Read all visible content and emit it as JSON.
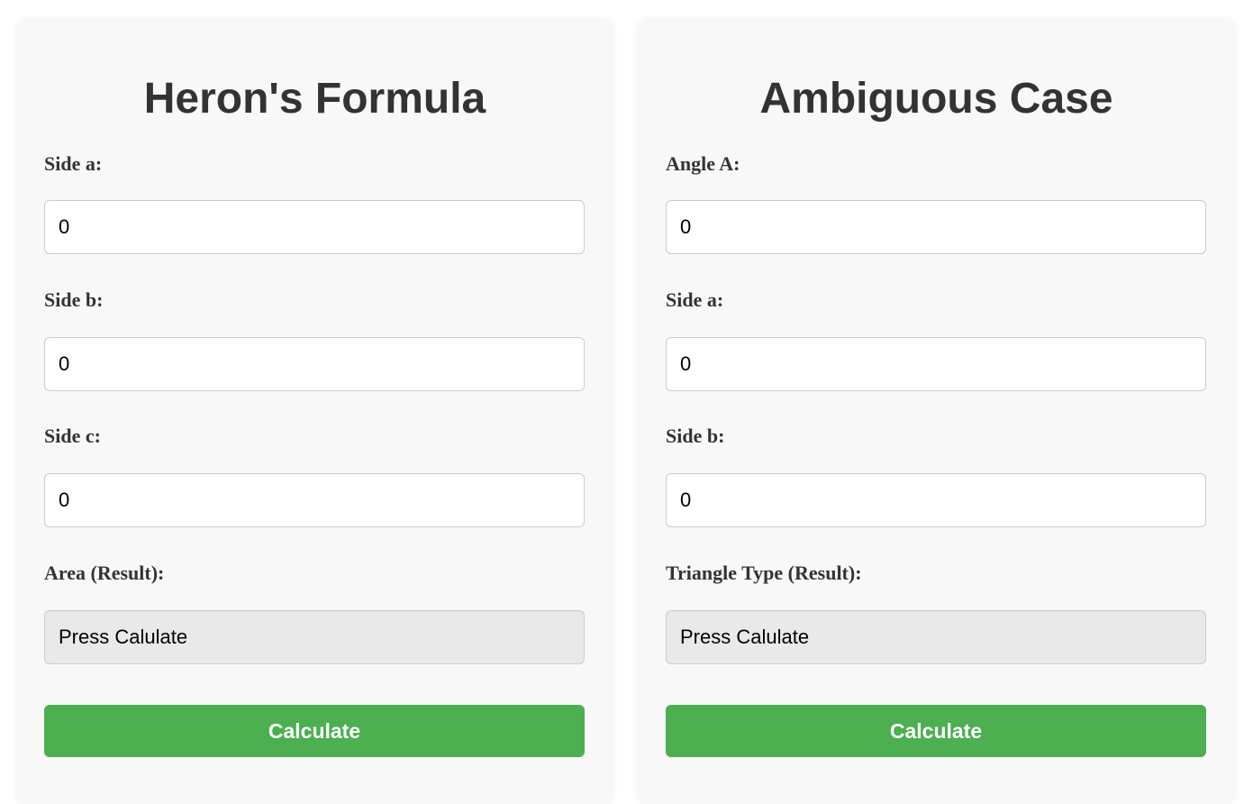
{
  "heron": {
    "title": "Heron's Formula",
    "fields": [
      {
        "label": "Side a:",
        "value": "0"
      },
      {
        "label": "Side b:",
        "value": "0"
      },
      {
        "label": "Side c:",
        "value": "0"
      }
    ],
    "result": {
      "label": "Area (Result):",
      "value": "Press Calulate"
    },
    "button_label": "Calculate"
  },
  "ambiguous": {
    "title": "Ambiguous Case",
    "fields": [
      {
        "label": "Angle A:",
        "value": "0"
      },
      {
        "label": "Side a:",
        "value": "0"
      },
      {
        "label": "Side b:",
        "value": "0"
      }
    ],
    "result": {
      "label": "Triangle Type (Result):",
      "value": "Press Calulate"
    },
    "button_label": "Calculate"
  },
  "colors": {
    "button": "#4caf50",
    "panel_background": "#f8f8f8",
    "result_background": "#e9e9e9",
    "heading_text": "#333333"
  }
}
